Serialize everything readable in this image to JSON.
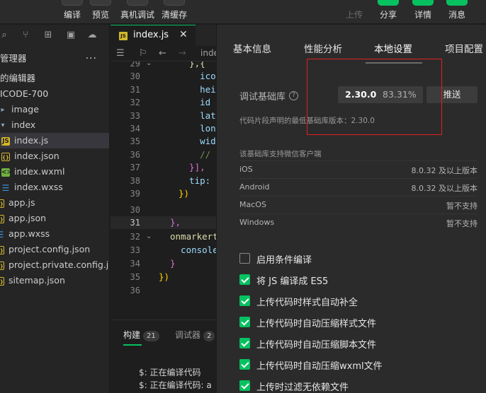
{
  "toolbar": {
    "compile": "编译",
    "preview": "预览",
    "remote_debug": "真机调试",
    "clear_cache": "清缓存",
    "upload": "上传",
    "share": "分享",
    "details": "详情",
    "messages": "消息"
  },
  "sidebar": {
    "header": "管理器",
    "more": "···",
    "section_open_editors": "的编辑器",
    "project": "ICODE-700",
    "files": [
      {
        "name": "image",
        "type": "folder"
      },
      {
        "name": "index",
        "type": "folder"
      },
      {
        "name": "index.js",
        "type": "js"
      },
      {
        "name": "index.json",
        "type": "json"
      },
      {
        "name": "index.wxml",
        "type": "wxml"
      },
      {
        "name": "index.wxss",
        "type": "wxss"
      },
      {
        "name": "app.js",
        "type": "js"
      },
      {
        "name": "app.json",
        "type": "json"
      },
      {
        "name": "app.wxss",
        "type": "wxss"
      },
      {
        "name": "project.config.json",
        "type": "json"
      },
      {
        "name": "project.private.config.js...",
        "type": "json"
      },
      {
        "name": "sitemap.json",
        "type": "json"
      }
    ]
  },
  "editor": {
    "tab_label": "index.js",
    "tab_close": "✕",
    "breadcrumb": "inde",
    "lines": [
      {
        "n": "29",
        "text": "  },{"
      },
      {
        "n": "30",
        "text": "    ico"
      },
      {
        "n": "31",
        "text": "    hei"
      },
      {
        "n": "32",
        "text": "    id"
      },
      {
        "n": "33",
        "text": "    lat"
      },
      {
        "n": "34",
        "text": "    lon"
      },
      {
        "n": "35",
        "text": "    wid"
      },
      {
        "n": "36",
        "text": "    //"
      },
      {
        "n": "37",
        "text": "  }],"
      },
      {
        "n": "38",
        "text": "  tip:"
      },
      {
        "n": "39",
        "text": "})"
      },
      {
        "n": "30",
        "text": ""
      },
      {
        "n": "31",
        "text": "},"
      },
      {
        "n": "32",
        "text": "onmarkert"
      },
      {
        "n": "33",
        "text": "  console"
      },
      {
        "n": "34",
        "text": "}"
      },
      {
        "n": "35",
        "text": "})"
      },
      {
        "n": "36",
        "text": ""
      }
    ]
  },
  "bottom_panel": {
    "tab_build": "构建",
    "tab_build_count": "21",
    "tab_debugger": "调试器",
    "tab_debugger_count": "2",
    "output": [
      "$: 正在编译代码",
      "$: 正在编译代码: a"
    ]
  },
  "settings": {
    "tabs": [
      "基本信息",
      "性能分析",
      "本地设置",
      "项目配置"
    ],
    "active_tab": "本地设置",
    "lib_label": "调试基础库",
    "help_icon": "?",
    "lib_version": "2.30.0",
    "lib_percent": "83.31%",
    "push_button": "推送",
    "lib_hint": "代码片段声明的最低基础库版本：2.30.0",
    "clients_title": "该基础库支持微信客户端",
    "clients": [
      {
        "name": "iOS",
        "status": "8.0.32 及以上版本"
      },
      {
        "name": "Android",
        "status": "8.0.32 及以上版本"
      },
      {
        "name": "MacOS",
        "status": "暂不支持"
      },
      {
        "name": "Windows",
        "status": "暂不支持"
      }
    ],
    "options": [
      {
        "label": "启用条件编译",
        "checked": false
      },
      {
        "label": "将 JS 编译成 ES5",
        "checked": true
      },
      {
        "label": "上传代码时样式自动补全",
        "checked": true
      },
      {
        "label": "上传代码时自动压缩样式文件",
        "checked": true
      },
      {
        "label": "上传代码时自动压缩脚本文件",
        "checked": true
      },
      {
        "label": "上传代码时自动压缩wxml文件",
        "checked": true
      },
      {
        "label": "上传时过滤无依赖文件",
        "checked": true
      }
    ]
  },
  "colors": {
    "accent": "#07c160",
    "highlight_box": "#e02020"
  }
}
